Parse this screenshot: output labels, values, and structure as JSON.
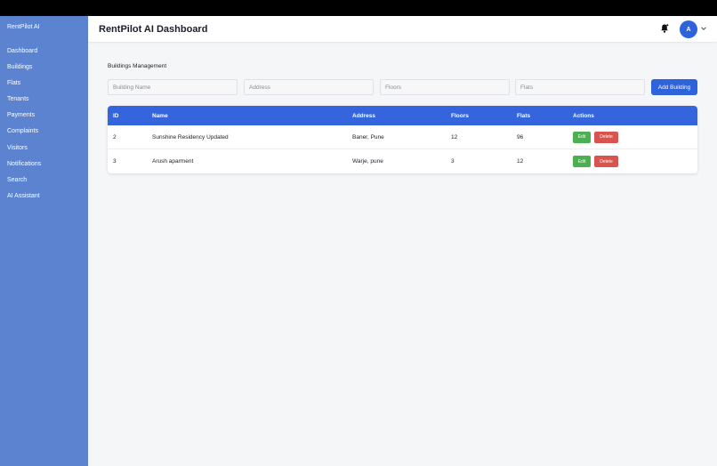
{
  "sidebar": {
    "brand": "RentPilot AI",
    "items": [
      {
        "label": "Dashboard"
      },
      {
        "label": "Buildings"
      },
      {
        "label": "Flats"
      },
      {
        "label": "Tenants"
      },
      {
        "label": "Payments"
      },
      {
        "label": "Complaints"
      },
      {
        "label": "Visitors"
      },
      {
        "label": "Notifications"
      },
      {
        "label": "Search"
      },
      {
        "label": "AI Assistant"
      }
    ],
    "background": "#5b83d0"
  },
  "header": {
    "title": "RentPilot AI Dashboard",
    "avatar_initial": "A",
    "bell_icon": "bell-icon",
    "chevron_icon": "chevron-down-icon"
  },
  "buildings": {
    "section_title": "Buildings Management",
    "form": {
      "name_placeholder": "Building Name",
      "address_placeholder": "Address",
      "floors_placeholder": "Floors",
      "flats_placeholder": "Flats",
      "add_label": "Add Building"
    },
    "table": {
      "headers": {
        "id": "ID",
        "name": "Name",
        "address": "Address",
        "floors": "Floors",
        "flats": "Flats",
        "actions": "Actions"
      },
      "rows": [
        {
          "id": "2",
          "name": "Sunshine Residency Updated",
          "address": "Baner, Pune",
          "floors": "12",
          "flats": "96",
          "edit": "Edit",
          "delete": "Delete"
        },
        {
          "id": "3",
          "name": "Arush aparment",
          "address": "Warje, pune",
          "floors": "3",
          "flats": "12",
          "edit": "Edit",
          "delete": "Delete"
        }
      ]
    }
  },
  "colors": {
    "accent": "#2f63dc",
    "table_header": "#3565dd",
    "edit": "#4caf50",
    "delete": "#d9534f"
  }
}
